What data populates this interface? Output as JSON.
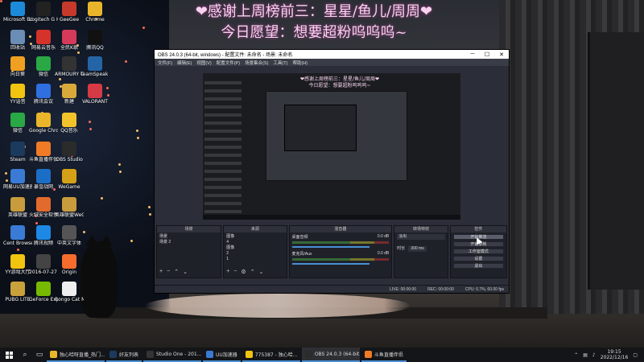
{
  "banner": {
    "line1": "❤感谢上周榜前三：星星/鱼儿/周周❤",
    "line2": "今日愿望：想要超粉呜呜呜~"
  },
  "desktop_icons": [
    {
      "label": "Microsoft Edge",
      "icon": "edge-icon",
      "color": "#1c8ad8"
    },
    {
      "label": "Logitech G HUB",
      "icon": "logitech-icon",
      "color": "#222"
    },
    {
      "label": "GeeGee",
      "icon": "geegee-icon",
      "color": "#c73a2b"
    },
    {
      "label": "Chrome",
      "icon": "chrome-icon",
      "color": "#e9b52a"
    },
    {
      "label": "回收站",
      "icon": "recycle-bin-icon",
      "color": "#6b8db5"
    },
    {
      "label": "网易云音乐",
      "icon": "netease-music-icon",
      "color": "#d5322b"
    },
    {
      "label": "全民K歌",
      "icon": "kge-icon",
      "color": "#d53a5a"
    },
    {
      "label": "腾讯QQ",
      "icon": "qq-icon",
      "color": "#111"
    },
    {
      "label": "向日葵",
      "icon": "sunflower-icon",
      "color": "#f0a020"
    },
    {
      "label": "微信",
      "icon": "wechat-icon",
      "color": "#2aa845"
    },
    {
      "label": "ARMOURY CRATE",
      "icon": "armoury-icon",
      "color": "#333"
    },
    {
      "label": "TeamSpeak 3",
      "icon": "teamspeak-icon",
      "color": "#2465a7"
    },
    {
      "label": "YY语音",
      "icon": "yy-icon",
      "color": "#f1c40f"
    },
    {
      "label": "腾讯会议",
      "icon": "tencent-meeting-icon",
      "color": "#2f6fe0"
    },
    {
      "label": "新建",
      "icon": "folder-icon",
      "color": "#d8a83a"
    },
    {
      "label": "VALORANT",
      "icon": "valorant-icon",
      "color": "#d63a45"
    },
    {
      "label": "微信",
      "icon": "wechat-icon",
      "color": "#2aa845"
    },
    {
      "label": "Google Chrome",
      "icon": "chrome-icon",
      "color": "#e9b52a"
    },
    {
      "label": "QQ音乐",
      "icon": "qq-music-icon",
      "color": "#f3c32b"
    },
    {
      "label": "Steam",
      "icon": "steam-icon",
      "color": "#1b3a5e"
    },
    {
      "label": "斗鱼直播伴侣",
      "icon": "douyu-icon",
      "color": "#f07a26"
    },
    {
      "label": "OBS Studio",
      "icon": "obs-icon",
      "color": "#2b2b2b"
    },
    {
      "label": "网易UU加速器",
      "icon": "uu-icon",
      "color": "#3a7bd5"
    },
    {
      "label": "暴雪战网",
      "icon": "battlenet-icon",
      "color": "#1a6ec6"
    },
    {
      "label": "WeGame",
      "icon": "wegame-icon",
      "color": "#d4a017"
    },
    {
      "label": "英雄联盟",
      "icon": "lol-icon",
      "color": "#c89b3c"
    },
    {
      "label": "火绒安全软件",
      "icon": "huorong-icon",
      "color": "#e26a2c"
    },
    {
      "label": "英雄联盟WeGame平台",
      "icon": "lol-wegame-icon",
      "color": "#c89b3c"
    },
    {
      "label": "Cent Browser",
      "icon": "cent-browser-icon",
      "color": "#3a7bd5"
    },
    {
      "label": "腾讯视频",
      "icon": "tencent-video-icon",
      "color": "#1e88e5"
    },
    {
      "label": "中英文字体",
      "icon": "font-icon",
      "color": "#555"
    },
    {
      "label": "YY游戏大厅",
      "icon": "yy-game-icon",
      "color": "#f1c40f"
    },
    {
      "label": "2016-07-27 PreSonus",
      "icon": "presonus-icon",
      "color": "#444"
    },
    {
      "label": "Origin",
      "icon": "origin-icon",
      "color": "#f56c2d"
    },
    {
      "label": "PUBG LITE",
      "icon": "pubg-icon",
      "color": "#c9a13b"
    },
    {
      "label": "GeForce Experience",
      "icon": "geforce-icon",
      "color": "#76b900"
    },
    {
      "label": "Bongo Cat Mver",
      "icon": "bongo-cat-icon",
      "color": "#eee"
    }
  ],
  "obs": {
    "title": "OBS 24.0.3 (64-bit, windows) - 配置文件: 未命名 - 场景: 未命名",
    "menu": [
      "文件(F)",
      "编辑(E)",
      "视图(V)",
      "配置文件(P)",
      "场景集合(S)",
      "工具(T)",
      "帮助(H)"
    ],
    "mini_banner_1": "❤感谢上周榜前三：星星/鱼儿/周周❤",
    "mini_banner_2": "今日愿望：想要超粉呜呜呜~",
    "docks": {
      "scenes": {
        "title": "场景",
        "items": [
          "场景",
          "场景 2"
        ]
      },
      "sources": {
        "title": "来源",
        "items": [
          "图像",
          "4",
          "图像",
          "2",
          "1"
        ]
      },
      "mixer": {
        "title": "混音器",
        "channels": [
          {
            "name": "桌面音频",
            "level": "0.0 dB"
          },
          {
            "name": "麦克风/Aux",
            "level": "0.0 dB"
          }
        ]
      },
      "transitions": {
        "title": "转场特效",
        "type": "淡出",
        "duration_label": "时长",
        "duration": "300 ms"
      },
      "controls": {
        "title": "控件",
        "buttons": [
          "开始推流",
          "开始录制",
          "工作室模式",
          "设置",
          "退出"
        ]
      }
    },
    "status": {
      "live": "LIVE: 00:00:00",
      "rec": "REC: 00:00:00",
      "cpu": "CPU: 0.7%, 60.00 fps"
    }
  },
  "taskbar": {
    "tasks": [
      {
        "label": "独心哈呀直播_热门...",
        "color": "#e9b52a"
      },
      {
        "label": "好友列表",
        "color": "#1b3a5e"
      },
      {
        "label": "Studio One - 201...",
        "color": "#333"
      },
      {
        "label": "UU加速器",
        "color": "#3a7bd5"
      },
      {
        "label": "775387 - 独心哈...",
        "color": "#f1c40f"
      },
      {
        "label": "OBS 24.0.3 (64-bit...",
        "color": "#2b2b2b"
      },
      {
        "label": "斗鱼直播伴侣",
        "color": "#f07a26"
      }
    ],
    "time": "19:15",
    "date": "2022/12/16"
  }
}
